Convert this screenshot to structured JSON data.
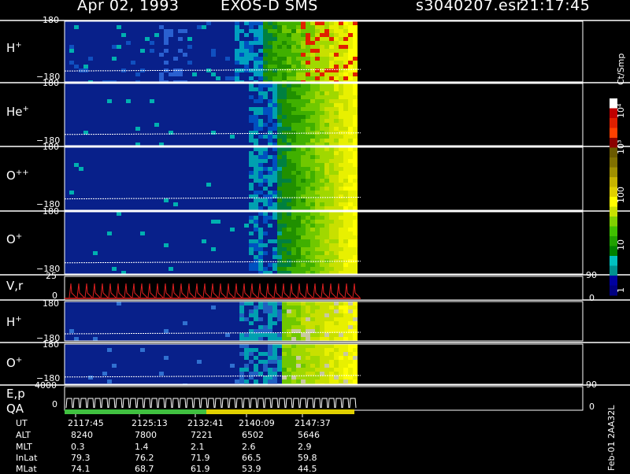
{
  "header": {
    "date": "Apr 02, 1993",
    "instrument": "EXOS-D SMS",
    "file": "s3040207.esr",
    "time": "21:17:45"
  },
  "panels": [
    {
      "id": "h1",
      "species": "H",
      "charge": "+",
      "top_tick": "180",
      "bottom_tick": "−180"
    },
    {
      "id": "he",
      "species": "He",
      "charge": "+",
      "top_tick": "180",
      "bottom_tick": "−180"
    },
    {
      "id": "opp",
      "species": "O",
      "charge": "++",
      "top_tick": "180",
      "bottom_tick": "−180"
    },
    {
      "id": "o1",
      "species": "O",
      "charge": "+",
      "top_tick": "180",
      "bottom_tick": "−180"
    },
    {
      "id": "h2",
      "species": "H",
      "charge": "+",
      "top_tick": "180",
      "bottom_tick": "−180"
    },
    {
      "id": "o2",
      "species": "O",
      "charge": "+",
      "top_tick": "180",
      "bottom_tick": "−180"
    }
  ],
  "vr_panel": {
    "label": "V,r",
    "top_tick": "25",
    "zero_tick": "0",
    "right_top": "90",
    "right_zero": "0"
  },
  "ep_panel": {
    "label_top": "E,p",
    "label_bottom": "QA",
    "top_tick": "4000",
    "zero_tick": "0",
    "right_top": "90",
    "right_zero": "0"
  },
  "ephemeris": {
    "rows": [
      {
        "label": "UT",
        "values": [
          "2117:45",
          "2125:13",
          "2132:41",
          "2140:09",
          "2147:37"
        ]
      },
      {
        "label": "ALT",
        "values": [
          "8240",
          "7800",
          "7221",
          "6502",
          "5646"
        ]
      },
      {
        "label": "MLT",
        "values": [
          "0.3",
          "1.4",
          "2.1",
          "2.6",
          "2.9"
        ]
      },
      {
        "label": "InLat",
        "values": [
          "79.3",
          "76.2",
          "71.9",
          "66.5",
          "59.8"
        ]
      },
      {
        "label": "MLat",
        "values": [
          "74.1",
          "68.7",
          "61.9",
          "53.9",
          "44.5"
        ]
      }
    ]
  },
  "colorbar": {
    "unit": "Ct/Smp",
    "labels": [
      "10⁴",
      "10³",
      "100",
      "10",
      "1"
    ],
    "colors": [
      "#ffffff",
      "#c00000",
      "#e02000",
      "#ff4000",
      "#8b0000",
      "#6b5a00",
      "#807000",
      "#a09000",
      "#c8b400",
      "#e0d000",
      "#ffff00",
      "#c8e000",
      "#80d000",
      "#40c000",
      "#20a000",
      "#008000",
      "#00c0c0",
      "#009090",
      "#0000a0",
      "#000080"
    ]
  },
  "side_id": "Feb-01 2AA32L",
  "chart_data": {
    "type": "heatmap",
    "title": "Apr 02, 1993   EXOS-D SMS",
    "x": [
      "2117:45",
      "2125:13",
      "2132:41",
      "2140:09",
      "2147:37"
    ],
    "xlabel": "UT",
    "ylim": [
      -180,
      180
    ],
    "colorbar_unit": "Ct/Smp",
    "colorbar_range": [
      1,
      10000
    ],
    "colorbar_scale": "log",
    "series": [
      {
        "name": "H+"
      },
      {
        "name": "He+"
      },
      {
        "name": "O++"
      },
      {
        "name": "O+"
      },
      {
        "name": "H+"
      },
      {
        "name": "O+"
      }
    ]
  }
}
